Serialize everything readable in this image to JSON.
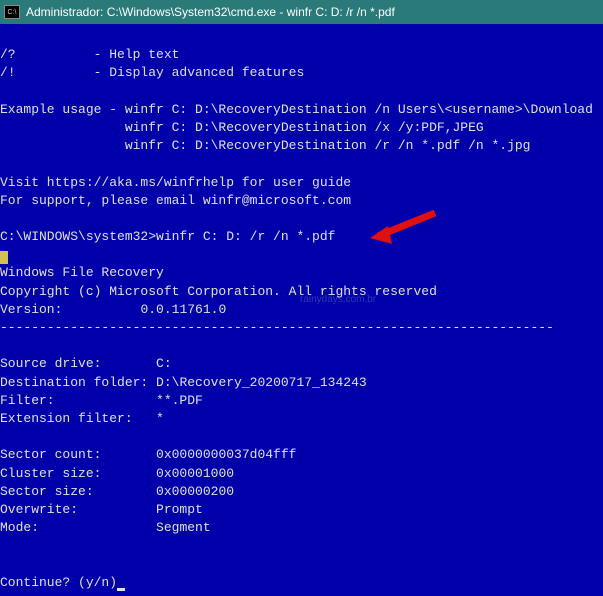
{
  "titlebar": {
    "icon_text": "C:\\",
    "text": "Administrador: C:\\Windows\\System32\\cmd.exe - winfr  C: D: /r /n *.pdf"
  },
  "help": {
    "line1": "/?          - Help text",
    "line2": "/!          - Display advanced features"
  },
  "examples": {
    "intro": "Example usage - winfr C: D:\\RecoveryDestination /n Users\\<username>\\Download",
    "line2": "                winfr C: D:\\RecoveryDestination /x /y:PDF,JPEG",
    "line3": "                winfr C: D:\\RecoveryDestination /r /n *.pdf /n *.jpg"
  },
  "links": {
    "visit": "Visit https://aka.ms/winfrhelp for user guide",
    "support": "For support, please email winfr@microsoft.com"
  },
  "prompt": {
    "path": "C:\\WINDOWS\\system32>",
    "command": "winfr C: D: /r /n *.pdf"
  },
  "app": {
    "name": "Windows File Recovery",
    "copyright": "Copyright (c) Microsoft Corporation. All rights reserved",
    "version_label": "Version:",
    "version_value": "0.0.11761.0"
  },
  "separator": "-----------------------------------------------------------------------",
  "info": {
    "source_drive_label": "Source drive:",
    "source_drive_value": "C:",
    "dest_label": "Destination folder:",
    "dest_value": "D:\\Recovery_20200717_134243",
    "filter_label": "Filter:",
    "filter_value": "**.PDF",
    "ext_filter_label": "Extension filter:",
    "ext_filter_value": "*",
    "sector_count_label": "Sector count:",
    "sector_count_value": "0x0000000037d04fff",
    "cluster_size_label": "Cluster size:",
    "cluster_size_value": "0x00001000",
    "sector_size_label": "Sector size:",
    "sector_size_value": "0x00000200",
    "overwrite_label": "Overwrite:",
    "overwrite_value": "Prompt",
    "mode_label": "Mode:",
    "mode_value": "Segment"
  },
  "continue_prompt": "Continue? (y/n)",
  "watermark": "rainydays.com.br",
  "arrow_color": "#e01010"
}
